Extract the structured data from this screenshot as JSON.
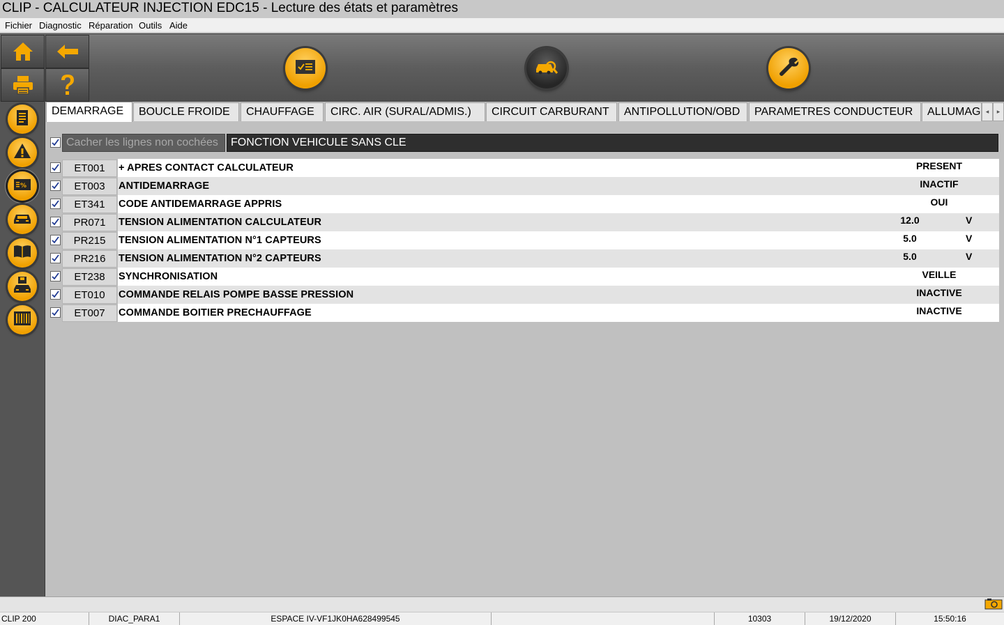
{
  "window": {
    "title": "CLIP - CALCULATEUR INJECTION EDC15 - Lecture des états et paramètres"
  },
  "menu": [
    "Fichier",
    "Diagnostic",
    "Réparation",
    "Outils",
    "Aide"
  ],
  "toolbar": {
    "left_buttons": [
      "home-icon",
      "back-arrow-icon",
      "printer-icon",
      "help-icon"
    ],
    "round_buttons": [
      "checklist-icon",
      "vehicle-scan-icon",
      "wrench-icon"
    ]
  },
  "sidebar": {
    "buttons": [
      "document-icon",
      "warning-icon",
      "states-parameters-icon",
      "vehicle-icon",
      "manual-icon",
      "save-vehicle-icon",
      "barcode-icon"
    ]
  },
  "tabs": [
    "DEMARRAGE",
    "BOUCLE FROIDE",
    "CHAUFFAGE",
    "CIRC. AIR (SURAL/ADMIS.)",
    "CIRCUIT CARBURANT",
    "ANTIPOLLUTION/OBD",
    "PARAMETRES CONDUCTEUR",
    "ALLUMAGE"
  ],
  "active_tab": "DEMARRAGE",
  "tab_scroll": {
    "left": "◂",
    "right": "▸"
  },
  "filter": {
    "hide_unchecked_label": "Cacher les lignes non cochées",
    "hide_unchecked_checked": true,
    "function_label": "FONCTION VEHICULE SANS CLE"
  },
  "rows": [
    {
      "checked": true,
      "code": "ET001",
      "label": "+ APRES CONTACT CALCULATEUR",
      "value": "PRESENT",
      "unit": ""
    },
    {
      "checked": true,
      "code": "ET003",
      "label": "ANTIDEMARRAGE",
      "value": "INACTIF",
      "unit": ""
    },
    {
      "checked": true,
      "code": "ET341",
      "label": "CODE ANTIDEMARRAGE APPRIS",
      "value": "OUI",
      "unit": ""
    },
    {
      "checked": true,
      "code": "PR071",
      "label": "TENSION ALIMENTATION CALCULATEUR",
      "value": "12.0",
      "unit": "V"
    },
    {
      "checked": true,
      "code": "PR215",
      "label": "TENSION ALIMENTATION N°1 CAPTEURS",
      "value": "5.0",
      "unit": "V"
    },
    {
      "checked": true,
      "code": "PR216",
      "label": "TENSION ALIMENTATION N°2 CAPTEURS",
      "value": "5.0",
      "unit": "V"
    },
    {
      "checked": true,
      "code": "ET238",
      "label": "SYNCHRONISATION",
      "value": "VEILLE",
      "unit": ""
    },
    {
      "checked": true,
      "code": "ET010",
      "label": "COMMANDE RELAIS POMPE BASSE PRESSION",
      "value": "INACTIVE",
      "unit": ""
    },
    {
      "checked": true,
      "code": "ET007",
      "label": "COMMANDE BOITIER PRECHAUFFAGE",
      "value": "INACTIVE",
      "unit": ""
    }
  ],
  "status": {
    "device": "CLIP 200",
    "diag": "DIAC_PARA1",
    "vehicle": "ESPACE IV-VF1JK0HA628499545",
    "blank": "",
    "code": "10303",
    "date": "19/12/2020",
    "time": "15:50:16",
    "camera_icon": "camera-icon"
  },
  "colors": {
    "accent": "#f0a000",
    "toolbar": "#5d5d5d",
    "sidebar": "#555555",
    "background": "#c0c0c0"
  }
}
